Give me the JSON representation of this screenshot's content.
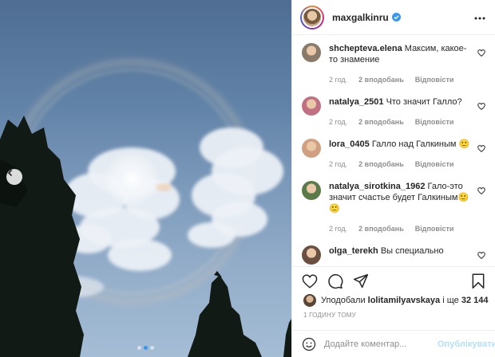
{
  "post": {
    "username": "maxgalkinru",
    "verified": true
  },
  "carousel": {
    "current": 2,
    "total": 3
  },
  "comments": [
    {
      "user": "shchepteva.elena",
      "text": "Максим, какое-то знамение",
      "time": "2 год.",
      "likes": "2 вподобань",
      "reply": "Відповісти",
      "avatar_color": "#8a7a6a"
    },
    {
      "user": "natalya_2501",
      "text": "Что значит Галло?",
      "time": "2 год.",
      "likes": "2 вподобань",
      "reply": "Відповісти",
      "avatar_color": "#c07080"
    },
    {
      "user": "lora_0405",
      "text": "Галло над Галкиным 🙂",
      "time": "2 год.",
      "likes": "2 вподобань",
      "reply": "Відповісти",
      "avatar_color": "#d0a080"
    },
    {
      "user": "natalya_sirotkina_1962",
      "text": "Гало-это значит счастье будет Галкиным🙂🙂",
      "time": "2 год.",
      "likes": "2 вподобань",
      "reply": "Відповісти",
      "avatar_color": "#5a7a4a"
    },
    {
      "user": "olga_terekh",
      "text": "Вы специально",
      "time": "",
      "likes": "",
      "reply": "",
      "avatar_color": "#6a5040"
    }
  ],
  "likes": {
    "prefix": "Уподобали",
    "user": "lolitamilyavskaya",
    "suffix": "і ще",
    "count": "32 144"
  },
  "timestamp": "1 ГОДИНУ ТОМУ",
  "add_comment": {
    "placeholder": "Додайте коментар...",
    "publish_label": "Опублікувати"
  },
  "colors": {
    "accent": "#3897f0",
    "verified": "#3897f0",
    "publish_disabled": "#b2dffc",
    "meta_text": "#8e8e8e"
  },
  "icons": {
    "more": "more-dots-icon",
    "heart": "heart-icon",
    "comment": "comment-icon",
    "share": "share-icon",
    "save": "bookmark-icon",
    "emoji": "smiley-icon",
    "prev": "chevron-left-icon"
  }
}
